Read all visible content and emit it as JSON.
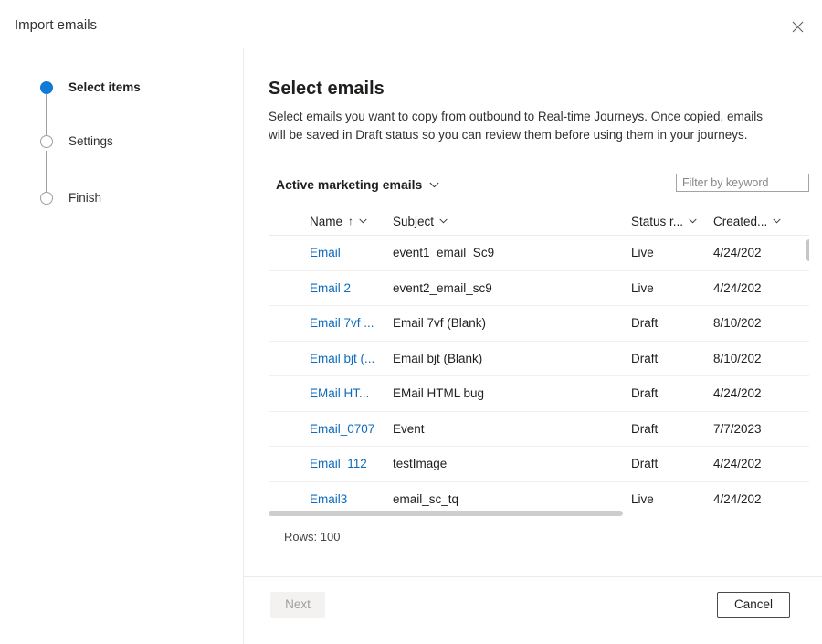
{
  "dialog": {
    "title": "Import emails",
    "close_icon": "close-icon"
  },
  "steps": [
    {
      "label": "Select items",
      "state": "active"
    },
    {
      "label": "Settings",
      "state": "inactive"
    },
    {
      "label": "Finish",
      "state": "inactive"
    }
  ],
  "page": {
    "heading": "Select emails",
    "description": "Select emails you want to copy from outbound to Real-time Journeys. Once copied, emails will be saved in Draft status so you can review them before using them in your journeys."
  },
  "toolbar": {
    "view_selector_label": "Active marketing emails",
    "view_selector_icon": "chevron-down-icon",
    "filter_placeholder": "Filter by keyword",
    "filter_value": ""
  },
  "grid": {
    "columns": [
      {
        "key": "name",
        "label": "Name",
        "sort": "↑",
        "menu_icon": "chevron-down-icon"
      },
      {
        "key": "subject",
        "label": "Subject",
        "sort": "",
        "menu_icon": "chevron-down-icon"
      },
      {
        "key": "status",
        "label": "Status r...",
        "sort": "",
        "menu_icon": "chevron-down-icon"
      },
      {
        "key": "created",
        "label": "Created...",
        "sort": "",
        "menu_icon": "chevron-down-icon"
      }
    ],
    "rows": [
      {
        "name": "Email",
        "subject": "event1_email_Sc9",
        "status": "Live",
        "created": "4/24/202"
      },
      {
        "name": "Email 2",
        "subject": "event2_email_sc9",
        "status": "Live",
        "created": "4/24/202"
      },
      {
        "name": "Email 7vf ...",
        "subject": "Email 7vf (Blank)",
        "status": "Draft",
        "created": "8/10/202"
      },
      {
        "name": "Email bjt (...",
        "subject": "Email bjt (Blank)",
        "status": "Draft",
        "created": "8/10/202"
      },
      {
        "name": "EMail HT...",
        "subject": "EMail HTML bug",
        "status": "Draft",
        "created": "4/24/202"
      },
      {
        "name": "Email_0707",
        "subject": "Event",
        "status": "Draft",
        "created": "7/7/2023"
      },
      {
        "name": "Email_112",
        "subject": "testImage",
        "status": "Draft",
        "created": "4/24/202"
      },
      {
        "name": "Email3",
        "subject": "email_sc_tq",
        "status": "Live",
        "created": "4/24/202"
      }
    ],
    "rows_count_label": "Rows: 100"
  },
  "footer": {
    "next_label": "Next",
    "cancel_label": "Cancel"
  },
  "colors": {
    "accent": "#0f7ad8",
    "link": "#0f6cbd",
    "divider": "#edebe9",
    "disabled_bg": "#f3f2f1"
  }
}
